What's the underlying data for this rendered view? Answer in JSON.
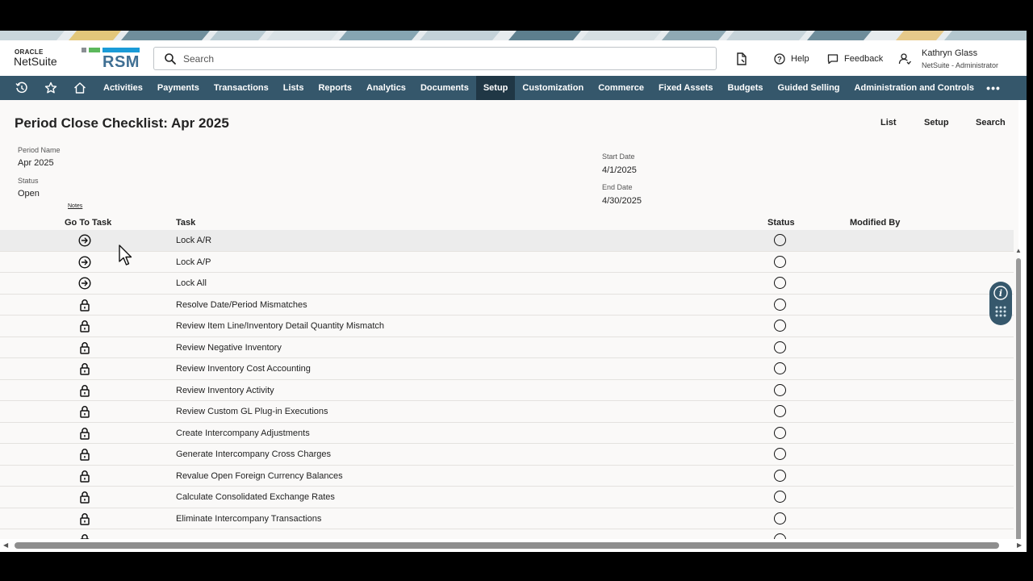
{
  "colors": {
    "nav_bg": "#35576b",
    "nav_active": "#203745",
    "content_bg": "#faf9f8",
    "rsm_blue": "#3f6f93",
    "rsm_green": "#5cb85c"
  },
  "header": {
    "oracle_label": "ORACLE",
    "netsuite_label": "NetSuite",
    "rsm_label": "RSM",
    "search_placeholder": "Search",
    "help_label": "Help",
    "feedback_label": "Feedback",
    "user_name": "Kathryn Glass",
    "user_role": "NetSuite - Administrator"
  },
  "nav": {
    "icons": [
      "recent-icon",
      "star-icon",
      "home-icon"
    ],
    "items": [
      "Activities",
      "Payments",
      "Transactions",
      "Lists",
      "Reports",
      "Analytics",
      "Documents",
      "Setup",
      "Customization",
      "Commerce",
      "Fixed Assets",
      "Budgets",
      "Guided Selling",
      "Administration and Controls"
    ],
    "active": "Setup",
    "more_label": "•••"
  },
  "page": {
    "title": "Period Close Checklist: Apr 2025",
    "actions": [
      "List",
      "Setup",
      "Search"
    ],
    "period_name_label": "Period Name",
    "period_name_value": "Apr 2025",
    "status_label": "Status",
    "status_value": "Open",
    "start_date_label": "Start Date",
    "start_date_value": "4/1/2025",
    "end_date_label": "End Date",
    "end_date_value": "4/30/2025",
    "notes_label": "Notes"
  },
  "table": {
    "headers": {
      "goto": "Go To Task",
      "task": "Task",
      "status": "Status",
      "modified_by": "Modified By"
    },
    "rows": [
      {
        "icon": "arrow-right-circle-icon",
        "task": "Lock A/R"
      },
      {
        "icon": "arrow-right-circle-icon",
        "task": "Lock A/P"
      },
      {
        "icon": "arrow-right-circle-icon",
        "task": "Lock All"
      },
      {
        "icon": "lock-icon",
        "task": "Resolve Date/Period Mismatches"
      },
      {
        "icon": "lock-icon",
        "task": "Review Item Line/Inventory Detail Quantity Mismatch"
      },
      {
        "icon": "lock-icon",
        "task": "Review Negative Inventory"
      },
      {
        "icon": "lock-icon",
        "task": "Review Inventory Cost Accounting"
      },
      {
        "icon": "lock-icon",
        "task": "Review Inventory Activity"
      },
      {
        "icon": "lock-icon",
        "task": "Review Custom GL Plug-in Executions"
      },
      {
        "icon": "lock-icon",
        "task": "Create Intercompany Adjustments"
      },
      {
        "icon": "lock-icon",
        "task": "Generate Intercompany Cross Charges"
      },
      {
        "icon": "lock-icon",
        "task": "Revalue Open Foreign Currency Balances"
      },
      {
        "icon": "lock-icon",
        "task": "Calculate Consolidated Exchange Rates"
      },
      {
        "icon": "lock-icon",
        "task": "Eliminate Intercompany Transactions"
      },
      {
        "icon": "lock-icon",
        "task": ""
      }
    ]
  }
}
